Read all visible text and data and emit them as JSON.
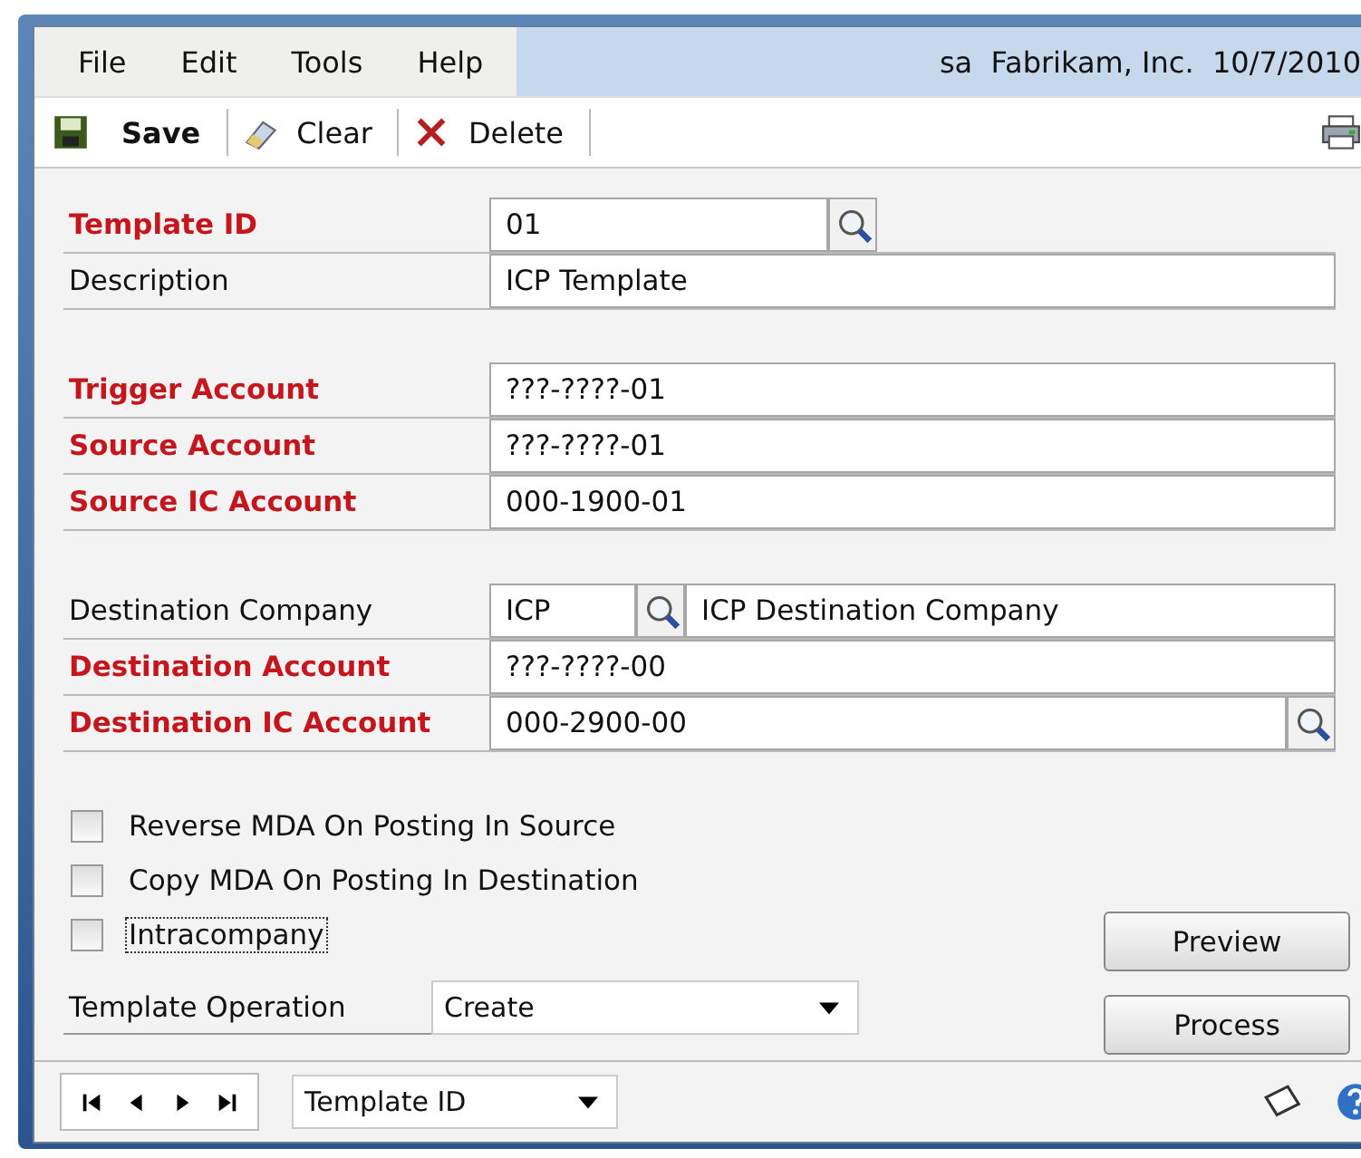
{
  "menu": [
    "File",
    "Edit",
    "Tools",
    "Help"
  ],
  "user_info": "sa  Fabrikam, Inc.  10/7/2010",
  "toolbar": [
    {
      "kind": "save",
      "label": "Save"
    },
    {
      "kind": "clear",
      "label": "Clear"
    },
    {
      "kind": "delete",
      "label": "Delete"
    }
  ],
  "field_groups": [
    [
      {
        "kind": "lookup",
        "label": "Template ID",
        "required": true,
        "value": "01"
      },
      {
        "kind": "text",
        "label": "Description",
        "required": false,
        "value": "ICP Template"
      }
    ],
    [
      {
        "kind": "text",
        "label": "Trigger Account",
        "required": true,
        "value": "???-????-01"
      },
      {
        "kind": "text",
        "label": "Source Account",
        "required": true,
        "value": "???-????-01"
      },
      {
        "kind": "text",
        "label": "Source IC Account",
        "required": true,
        "value": "000-1900-01"
      }
    ],
    [
      {
        "kind": "company",
        "label": "Destination Company",
        "required": false,
        "value": "ICP",
        "name": "ICP Destination Company"
      },
      {
        "kind": "text",
        "label": "Destination Account",
        "required": true,
        "value": "???-????-00"
      },
      {
        "kind": "wide_lookup",
        "label": "Destination IC Account",
        "required": true,
        "value": "000-2900-00"
      }
    ]
  ],
  "checkboxes": [
    {
      "label": "Reverse MDA On Posting In Source",
      "checked": false,
      "focused": false
    },
    {
      "label": "Copy MDA On Posting In Destination",
      "checked": false,
      "focused": false
    },
    {
      "label": "Intracompany",
      "checked": false,
      "focused": true
    }
  ],
  "template_operation": {
    "label": "Template Operation",
    "value": "Create"
  },
  "buttons": [
    "Preview",
    "Process"
  ],
  "sort_by": "Template ID"
}
